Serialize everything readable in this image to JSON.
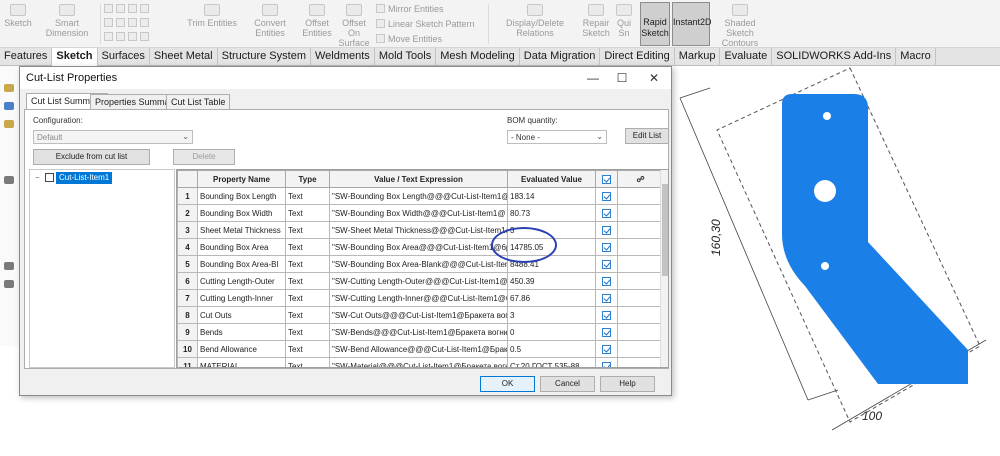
{
  "ribbon": {
    "sketch": "Sketch",
    "smart_dimension": "Smart Dimension",
    "trim_entities": "Trim Entities",
    "convert_entities": "Convert Entities",
    "offset_entities_1": "Offset",
    "offset_entities_2": "Entities",
    "offset_on_surface_1": "Offset On",
    "offset_on_surface_2": "Surface",
    "mirror_entities": "Mirror Entities",
    "linear_sketch_pattern": "Linear Sketch Pattern",
    "move_entities": "Move Entities",
    "display_delete_relations": "Display/Delete Relations",
    "repair_sketch_1": "Repair",
    "repair_sketch_2": "Sketch",
    "quick_snaps_1": "Qui",
    "quick_snaps_2": "Sn",
    "rapid_sketch_1": "Rapid",
    "rapid_sketch_2": "Sketch",
    "instant2d": "Instant2D",
    "shaded_contours_1": "Shaded Sketch",
    "shaded_contours_2": "Contours"
  },
  "tabs": [
    "Features",
    "Sketch",
    "Surfaces",
    "Sheet Metal",
    "Structure System",
    "Weldments",
    "Mold Tools",
    "Mesh Modeling",
    "Data Migration",
    "Direct Editing",
    "Markup",
    "Evaluate",
    "SOLIDWORKS Add-Ins",
    "Macro"
  ],
  "dialog": {
    "title": "Cut-List Properties",
    "tabs": [
      "Cut List Summary",
      "Properties Summary",
      "Cut List Table"
    ],
    "configuration_label": "Configuration:",
    "configuration_value": "Default",
    "bom_label": "BOM quantity:",
    "bom_value": "- None -",
    "edit_list": "Edit List",
    "exclude_button": "Exclude from cut list",
    "delete_button": "Delete",
    "tree_item": "Cut-List-Item1",
    "columns": [
      "",
      "Property Name",
      "Type",
      "Value / Text Expression",
      "Evaluated Value"
    ],
    "rows": [
      {
        "num": "1",
        "name": "Bounding Box Length",
        "type": "Text",
        "expr": "\"SW-Bounding Box Length@@@Cut-List-Item1@",
        "value": "183.14"
      },
      {
        "num": "2",
        "name": "Bounding Box Width",
        "type": "Text",
        "expr": "\"SW-Bounding Box Width@@@Cut-List-Item1@",
        "value": "80.73"
      },
      {
        "num": "3",
        "name": "Sheet Metal Thickness",
        "type": "Text",
        "expr": "\"SW-Sheet Metal Thickness@@@Cut-List-Item1@",
        "value": "3"
      },
      {
        "num": "4",
        "name": "Bounding Box Area",
        "type": "Text",
        "expr": "\"SW-Bounding Box Area@@@Cut-List-Item1@6p",
        "value": "14785.05"
      },
      {
        "num": "5",
        "name": "Bounding Box Area-Bl",
        "type": "Text",
        "expr": "\"SW-Bounding Box Area-Blank@@@Cut-List-Item",
        "value": "8488.41"
      },
      {
        "num": "6",
        "name": "Cutting Length-Outer",
        "type": "Text",
        "expr": "\"SW-Cutting Length-Outer@@@Cut-List-Item1@6",
        "value": "450.39"
      },
      {
        "num": "7",
        "name": "Cutting Length-Inner",
        "type": "Text",
        "expr": "\"SW-Cutting Length-Inner@@@Cut-List-Item1@6",
        "value": "67.86"
      },
      {
        "num": "8",
        "name": "Cut Outs",
        "type": "Text",
        "expr": "\"SW-Cut Outs@@@Cut-List-Item1@Бракета вогн",
        "value": "3"
      },
      {
        "num": "9",
        "name": "Bends",
        "type": "Text",
        "expr": "\"SW-Bends@@@Cut-List-Item1@Бракета вогню.",
        "value": "0"
      },
      {
        "num": "10",
        "name": "Bend Allowance",
        "type": "Text",
        "expr": "\"SW-Bend Allowance@@@Cut-List-Item1@Браке",
        "value": "0.5"
      },
      {
        "num": "11",
        "name": "MATERIAL",
        "type": "Text",
        "expr": "\"SW-Material@@@Cut-List-Item1@Бракета вогн",
        "value": "Ст.20 ГОСТ 535-88"
      }
    ],
    "ok": "OK",
    "cancel": "Cancel",
    "help": "Help"
  },
  "drawing": {
    "dim_height": "160,30",
    "dim_width": "100",
    "part_color": "#1a7fe6"
  }
}
